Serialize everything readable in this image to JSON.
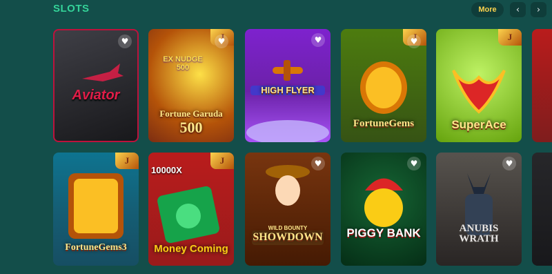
{
  "section": {
    "title": "SLOTS",
    "more_label": "More",
    "prev_icon": "‹",
    "next_icon": "›"
  },
  "colors": {
    "background": "#134e4a",
    "title": "#34d399",
    "more_text": "#fcd34d"
  },
  "games": [
    {
      "name": "Aviator",
      "subtitle": "",
      "has_badge": false
    },
    {
      "name": "Fortune Garuda",
      "subtitle": "500",
      "overlay": "EX NUDGE 500",
      "has_badge": true
    },
    {
      "name": "HIGH FLYER",
      "subtitle": "",
      "has_badge": false
    },
    {
      "name": "FortuneGems",
      "subtitle": "",
      "has_badge": true
    },
    {
      "name": "SuperAce",
      "subtitle": "",
      "has_badge": true
    },
    {
      "name": "FortuneGems3",
      "subtitle": "",
      "has_badge": true
    },
    {
      "name": "Money Coming",
      "subtitle": "",
      "overlay": "10000X",
      "has_badge": true
    },
    {
      "name": "SHOWDOWN",
      "subtitle": "",
      "overlay": "WILD BOUNTY",
      "has_badge": false
    },
    {
      "name": "PIGGY BANK",
      "subtitle": "",
      "has_badge": false
    },
    {
      "name": "ANUBIS WRATH",
      "subtitle": "",
      "has_badge": false
    }
  ],
  "heart_icon": "♥",
  "badge_glyph": "J"
}
